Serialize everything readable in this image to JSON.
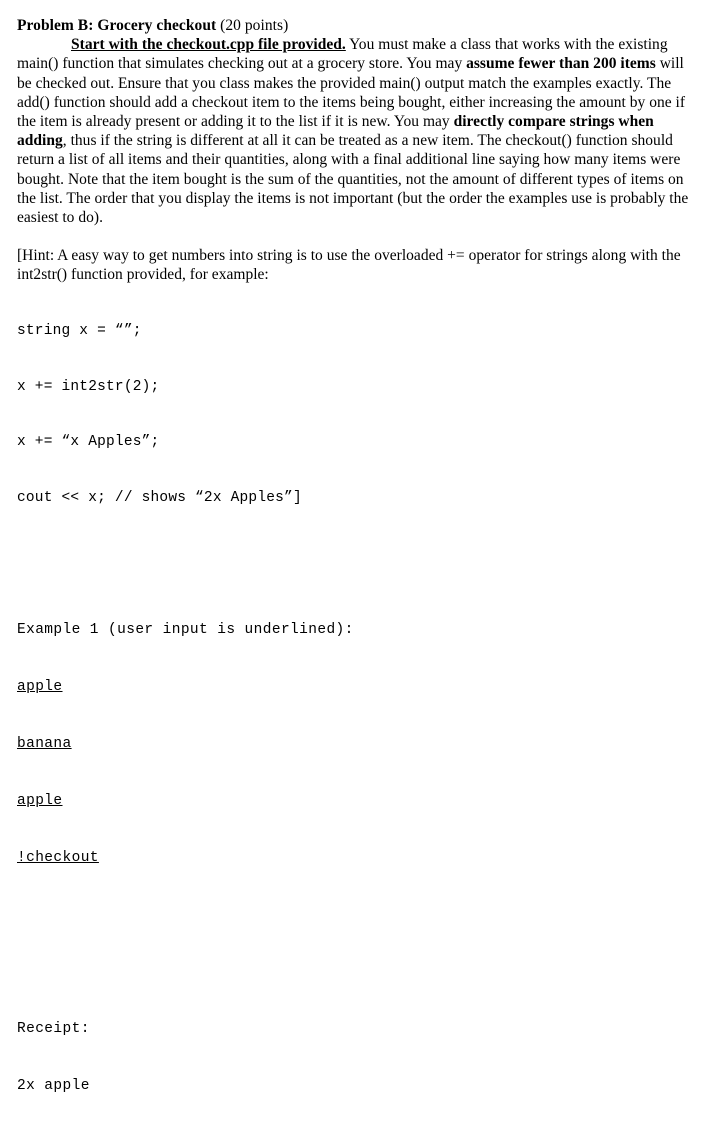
{
  "document": {
    "heading": {
      "title": "Problem B: Grocery checkout",
      "points": " (20 points)"
    },
    "paragraph_1": {
      "lead_bold_underlined": "Start with the checkout.cpp file provided.",
      "segment_1": "  You must make a class that works with the existing main() function that simulates checking out at a grocery store.  You may ",
      "bold_1": "assume fewer than 200 items",
      "segment_2": " will be checked out.  Ensure that you class makes the provided main() output match the examples exactly.  The add() function should add a checkout item to the items being bought, either increasing the amount by one if the item is already present or adding it to the list if it is new.  You may ",
      "bold_2": "directly compare strings when adding",
      "segment_3": ", thus if the string is different at all it can be treated as a new item.  The checkout() function should return a list of all items and their quantities, along with a final additional line saying how many items were bought.  Note that the item bought is the sum of the quantities, not the amount of different types of items on the list.  The order that you display the items is not important (but the order the examples use is probably the easiest to do)."
    },
    "hint": {
      "text": "[Hint: A easy way to get numbers into string is to use the overloaded += operator for strings along with the int2str() function provided, for example:"
    },
    "code_lines": [
      "string x = “”;",
      "x += int2str(2);",
      "x += “x Apples”;",
      "cout << x; // shows “2x Apples”]"
    ],
    "example": {
      "header": "Example 1 (user input is underlined):",
      "input_lines": [
        "apple",
        "banana",
        "apple",
        "!checkout"
      ],
      "output_lines": [
        "Receipt:",
        "2x apple"
      ]
    }
  }
}
